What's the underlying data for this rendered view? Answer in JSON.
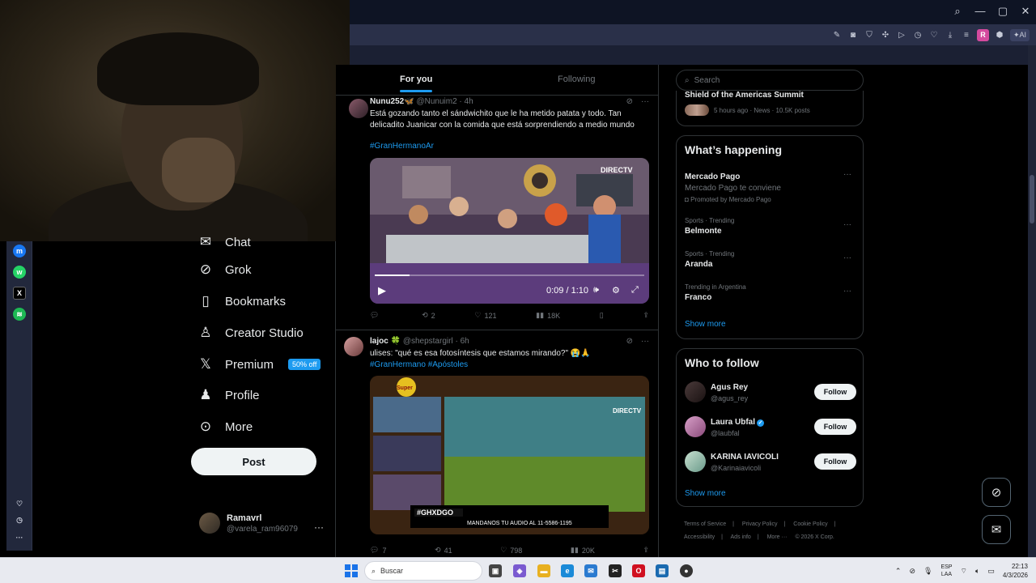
{
  "feed": {
    "tabs": [
      "For you",
      "Following"
    ],
    "tweets": [
      {
        "name": "Nunu252🦋",
        "handle": "@Nunuim2",
        "time": "4h",
        "text": "Está gozando tanto el sándwichito que le ha metido patata y todo. Tan delicadito Juanicar con la comida que está sorprendiendo a medio mundo",
        "hashtags": "#GranHermanoAr",
        "video_time": "0:09 / 1:10",
        "video_progress": 0.13,
        "stats": {
          "replies": "",
          "reposts": "2",
          "likes": "121",
          "views": "18K"
        }
      },
      {
        "name": "lajoc 🍀",
        "handle": "@shepstargirl",
        "time": "6h",
        "text": "ulises: \"qué es esa fotosíntesis que estamos mirando?\" 😭🙏",
        "hashtags": "#GranHermano #Apóstoles",
        "media_tag": "#GHXDGO",
        "media_caption": "MANDANOS TU AUDIO AL 11-5586-1195",
        "stats": {
          "replies": "7",
          "reposts": "41",
          "likes": "798",
          "views": "20K"
        }
      }
    ]
  },
  "nav": {
    "items": [
      {
        "label": "Chat",
        "icon": "chat-icon"
      },
      {
        "label": "Grok",
        "icon": "grok-icon"
      },
      {
        "label": "Bookmarks",
        "icon": "bookmark-icon"
      },
      {
        "label": "Creator Studio",
        "icon": "creator-icon"
      },
      {
        "label": "Premium",
        "icon": "x-logo-icon"
      },
      {
        "label": "Profile",
        "icon": "profile-icon"
      },
      {
        "label": "More",
        "icon": "more-circle-icon"
      }
    ],
    "premium_badge": "50% off",
    "post_label": "Post",
    "account": {
      "name": "Ramavrl",
      "handle": "@varela_ram96079"
    }
  },
  "sidebar": {
    "search_placeholder": "Search",
    "news": {
      "title": "Shield of the Americas Summit",
      "meta": "5 hours ago · News · 10.5K posts"
    },
    "happening": {
      "title": "What’s happening",
      "trends": [
        {
          "meta": "",
          "name": "Mercado Pago",
          "sub": "Mercado Pago te conviene",
          "promo": "Promoted by Mercado Pago"
        },
        {
          "meta": "Sports · Trending",
          "name": "Belmonte",
          "sub": "",
          "promo": ""
        },
        {
          "meta": "Sports · Trending",
          "name": "Aranda",
          "sub": "",
          "promo": ""
        },
        {
          "meta": "Trending in Argentina",
          "name": "Franco",
          "sub": "",
          "promo": ""
        }
      ],
      "show_more": "Show more"
    },
    "who_to_follow": {
      "title": "Who to follow",
      "users": [
        {
          "name": "Agus Rey",
          "handle": "@agus_rey",
          "verified": false
        },
        {
          "name": "Laura Ubfal",
          "handle": "@laubfal",
          "verified": true
        },
        {
          "name": "KARINA IAVICOLI",
          "handle": "@Karinaiavicoli",
          "verified": false
        }
      ],
      "follow_label": "Follow",
      "show_more": "Show more"
    },
    "footer": [
      "Terms of Service",
      "|",
      "Privacy Policy",
      "|",
      "Cookie Policy",
      "|",
      "Accessibility",
      "|",
      "Ads info",
      "|",
      "More ···",
      "© 2026 X Corp."
    ]
  },
  "taskbar": {
    "search": "Buscar",
    "lang_top": "ESP",
    "lang_bottom": "LAA",
    "time": "22:13",
    "date": "4/3/2026"
  }
}
